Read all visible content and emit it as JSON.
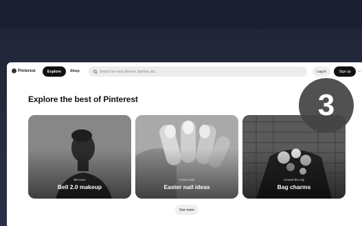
{
  "header": {
    "logo_text": "Pinterest",
    "explore_label": "Explore",
    "shop_label": "Shop",
    "search_placeholder": "Search for easy dinners, fashion, etc.",
    "login_label": "Log in",
    "signup_label": "Sign up"
  },
  "main": {
    "headline": "Explore the best of Pinterest",
    "cards": [
      {
        "kicker": "Bit more",
        "title": "Bell 2.0 makeup"
      },
      {
        "kicker": "Fresh nails",
        "title": "Easter nail ideas"
      },
      {
        "kicker": "Around the city",
        "title": "Bag charms"
      }
    ],
    "see_more_label": "See more"
  },
  "overlay": {
    "step_number": "3"
  },
  "colors": {
    "background": "#252a3d",
    "accent": "#111111",
    "badge": "#444444"
  }
}
